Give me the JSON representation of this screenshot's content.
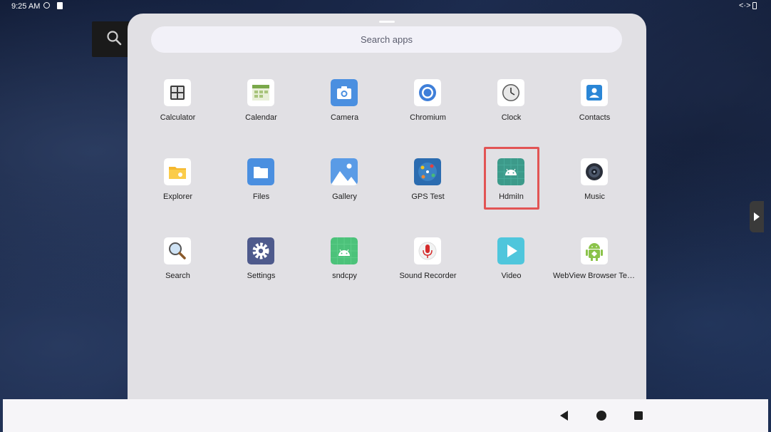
{
  "status_bar": {
    "time": "9:25 AM",
    "right_icons": "<·>"
  },
  "search": {
    "placeholder": "Search apps"
  },
  "apps": [
    {
      "label": "Calculator",
      "icon": "calculator-icon"
    },
    {
      "label": "Calendar",
      "icon": "calendar-icon"
    },
    {
      "label": "Camera",
      "icon": "camera-icon"
    },
    {
      "label": "Chromium",
      "icon": "chromium-icon"
    },
    {
      "label": "Clock",
      "icon": "clock-icon"
    },
    {
      "label": "Contacts",
      "icon": "contacts-icon"
    },
    {
      "label": "Explorer",
      "icon": "explorer-icon"
    },
    {
      "label": "Files",
      "icon": "files-icon"
    },
    {
      "label": "Gallery",
      "icon": "gallery-icon"
    },
    {
      "label": "GPS Test",
      "icon": "gps-test-icon"
    },
    {
      "label": "HdmiIn",
      "icon": "android-icon"
    },
    {
      "label": "Music",
      "icon": "music-icon"
    },
    {
      "label": "Search",
      "icon": "search-icon"
    },
    {
      "label": "Settings",
      "icon": "settings-icon"
    },
    {
      "label": "sndcpy",
      "icon": "android-icon"
    },
    {
      "label": "Sound Recorder",
      "icon": "sound-recorder-icon"
    },
    {
      "label": "Video",
      "icon": "video-icon"
    },
    {
      "label": "WebView Browser Tester",
      "icon": "webview-icon"
    }
  ],
  "highlighted_app": "HdmiIn",
  "highlight_color": "#e25454",
  "nav": {
    "back": "back-icon",
    "home": "home-icon",
    "recents": "recents-icon"
  }
}
